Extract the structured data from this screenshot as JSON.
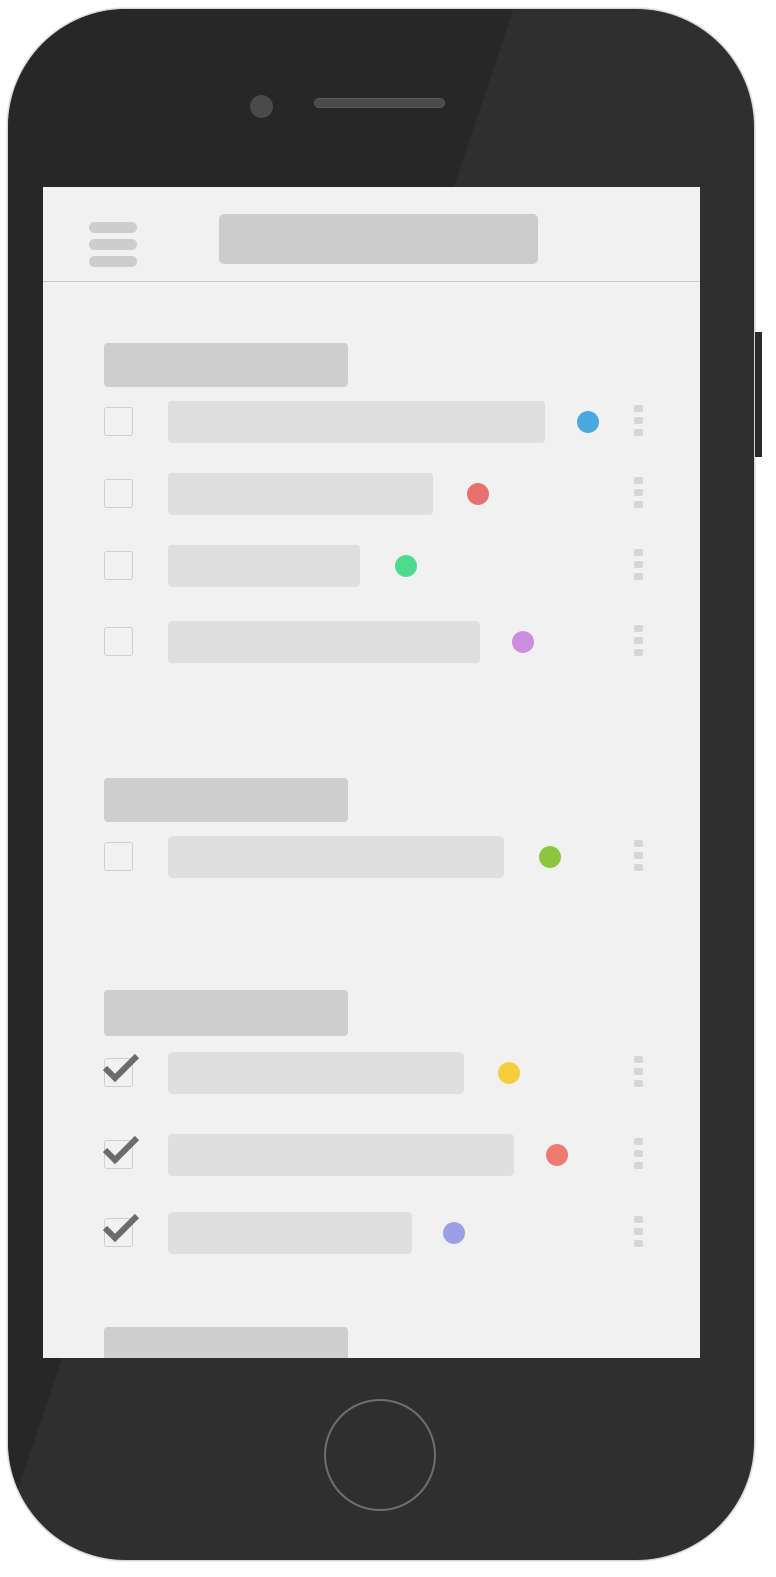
{
  "header": {
    "menu_icon": "hamburger-menu-icon"
  },
  "sections": [
    {
      "tasks": [
        {
          "done": false,
          "tag_color": "#4aa8e0"
        },
        {
          "done": false,
          "tag_color": "#e8706e"
        },
        {
          "done": false,
          "tag_color": "#4ddb8e"
        },
        {
          "done": false,
          "tag_color": "#cc8fe0"
        }
      ]
    },
    {
      "tasks": [
        {
          "done": false,
          "tag_color": "#8cc63f"
        }
      ]
    },
    {
      "tasks": [
        {
          "done": true,
          "tag_color": "#f5cf3b"
        },
        {
          "done": true,
          "tag_color": "#ee7a72"
        },
        {
          "done": true,
          "tag_color": "#9c9ee8"
        }
      ]
    },
    {
      "tasks": []
    }
  ],
  "colors": {
    "device_body": "#2f2f2f",
    "screen_background": "#f1f1f1",
    "placeholder": "#dfdfdf",
    "checkmark": "#6b6b6b"
  },
  "icons": {
    "checkbox": "checkbox-icon",
    "checkmark": "checkmark-icon",
    "more": "more-vertical-icon",
    "tag": "tag-dot-icon"
  }
}
